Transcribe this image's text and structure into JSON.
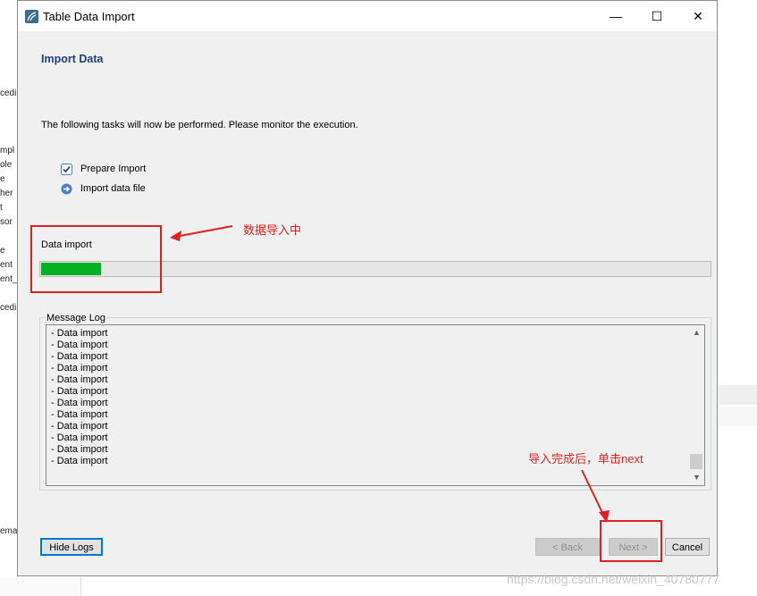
{
  "background_fragments": [
    "cedi",
    "mpl",
    "ole",
    "e",
    "her",
    "t",
    "sor",
    "e",
    "ent",
    "ent_",
    "cedi",
    "ema"
  ],
  "window": {
    "title": "Table Data Import",
    "minimize_glyph": "—",
    "maximize_glyph": "☐",
    "close_glyph": "✕"
  },
  "page": {
    "heading": "Import Data",
    "intro": "The following tasks will now be performed. Please monitor the execution."
  },
  "tasks": [
    {
      "label": "Prepare Import",
      "icon": "checkmark-icon"
    },
    {
      "label": "Import data file",
      "icon": "arrow-right-icon"
    }
  ],
  "progress": {
    "label": "Data import",
    "fraction": 0.09,
    "color": "#06b025"
  },
  "log": {
    "legend": "Message Log",
    "lines": [
      "- Data import",
      "- Data import",
      "- Data import",
      "- Data import",
      "- Data import",
      "- Data import",
      "- Data import",
      "- Data import",
      "- Data import",
      "- Data import",
      "- Data import",
      "- Data import"
    ]
  },
  "buttons": {
    "hide_logs": "Hide Logs",
    "back": "< Back",
    "next": "Next >",
    "cancel": "Cancel"
  },
  "annotations": {
    "importing": "数据导入中",
    "after_done": "导入完成后，单击next",
    "color": "#e02020"
  },
  "watermark": "https://blog.csdn.net/weixin_40780777"
}
